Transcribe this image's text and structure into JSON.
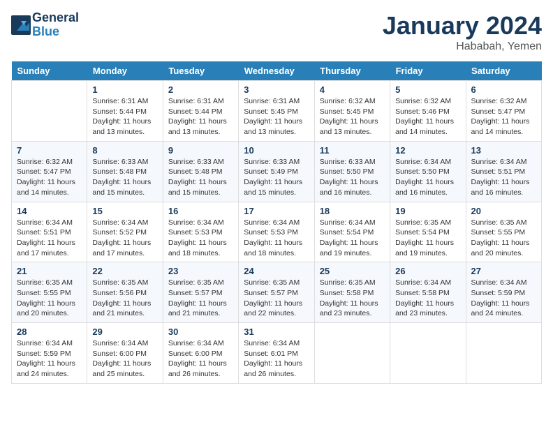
{
  "header": {
    "logo_line1": "General",
    "logo_line2": "Blue",
    "month_year": "January 2024",
    "location": "Hababah, Yemen"
  },
  "weekdays": [
    "Sunday",
    "Monday",
    "Tuesday",
    "Wednesday",
    "Thursday",
    "Friday",
    "Saturday"
  ],
  "weeks": [
    [
      {
        "num": "",
        "info": ""
      },
      {
        "num": "1",
        "info": "Sunrise: 6:31 AM\nSunset: 5:44 PM\nDaylight: 11 hours\nand 13 minutes."
      },
      {
        "num": "2",
        "info": "Sunrise: 6:31 AM\nSunset: 5:44 PM\nDaylight: 11 hours\nand 13 minutes."
      },
      {
        "num": "3",
        "info": "Sunrise: 6:31 AM\nSunset: 5:45 PM\nDaylight: 11 hours\nand 13 minutes."
      },
      {
        "num": "4",
        "info": "Sunrise: 6:32 AM\nSunset: 5:45 PM\nDaylight: 11 hours\nand 13 minutes."
      },
      {
        "num": "5",
        "info": "Sunrise: 6:32 AM\nSunset: 5:46 PM\nDaylight: 11 hours\nand 14 minutes."
      },
      {
        "num": "6",
        "info": "Sunrise: 6:32 AM\nSunset: 5:47 PM\nDaylight: 11 hours\nand 14 minutes."
      }
    ],
    [
      {
        "num": "7",
        "info": "Sunrise: 6:32 AM\nSunset: 5:47 PM\nDaylight: 11 hours\nand 14 minutes."
      },
      {
        "num": "8",
        "info": "Sunrise: 6:33 AM\nSunset: 5:48 PM\nDaylight: 11 hours\nand 15 minutes."
      },
      {
        "num": "9",
        "info": "Sunrise: 6:33 AM\nSunset: 5:48 PM\nDaylight: 11 hours\nand 15 minutes."
      },
      {
        "num": "10",
        "info": "Sunrise: 6:33 AM\nSunset: 5:49 PM\nDaylight: 11 hours\nand 15 minutes."
      },
      {
        "num": "11",
        "info": "Sunrise: 6:33 AM\nSunset: 5:50 PM\nDaylight: 11 hours\nand 16 minutes."
      },
      {
        "num": "12",
        "info": "Sunrise: 6:34 AM\nSunset: 5:50 PM\nDaylight: 11 hours\nand 16 minutes."
      },
      {
        "num": "13",
        "info": "Sunrise: 6:34 AM\nSunset: 5:51 PM\nDaylight: 11 hours\nand 16 minutes."
      }
    ],
    [
      {
        "num": "14",
        "info": "Sunrise: 6:34 AM\nSunset: 5:51 PM\nDaylight: 11 hours\nand 17 minutes."
      },
      {
        "num": "15",
        "info": "Sunrise: 6:34 AM\nSunset: 5:52 PM\nDaylight: 11 hours\nand 17 minutes."
      },
      {
        "num": "16",
        "info": "Sunrise: 6:34 AM\nSunset: 5:53 PM\nDaylight: 11 hours\nand 18 minutes."
      },
      {
        "num": "17",
        "info": "Sunrise: 6:34 AM\nSunset: 5:53 PM\nDaylight: 11 hours\nand 18 minutes."
      },
      {
        "num": "18",
        "info": "Sunrise: 6:34 AM\nSunset: 5:54 PM\nDaylight: 11 hours\nand 19 minutes."
      },
      {
        "num": "19",
        "info": "Sunrise: 6:35 AM\nSunset: 5:54 PM\nDaylight: 11 hours\nand 19 minutes."
      },
      {
        "num": "20",
        "info": "Sunrise: 6:35 AM\nSunset: 5:55 PM\nDaylight: 11 hours\nand 20 minutes."
      }
    ],
    [
      {
        "num": "21",
        "info": "Sunrise: 6:35 AM\nSunset: 5:55 PM\nDaylight: 11 hours\nand 20 minutes."
      },
      {
        "num": "22",
        "info": "Sunrise: 6:35 AM\nSunset: 5:56 PM\nDaylight: 11 hours\nand 21 minutes."
      },
      {
        "num": "23",
        "info": "Sunrise: 6:35 AM\nSunset: 5:57 PM\nDaylight: 11 hours\nand 21 minutes."
      },
      {
        "num": "24",
        "info": "Sunrise: 6:35 AM\nSunset: 5:57 PM\nDaylight: 11 hours\nand 22 minutes."
      },
      {
        "num": "25",
        "info": "Sunrise: 6:35 AM\nSunset: 5:58 PM\nDaylight: 11 hours\nand 23 minutes."
      },
      {
        "num": "26",
        "info": "Sunrise: 6:34 AM\nSunset: 5:58 PM\nDaylight: 11 hours\nand 23 minutes."
      },
      {
        "num": "27",
        "info": "Sunrise: 6:34 AM\nSunset: 5:59 PM\nDaylight: 11 hours\nand 24 minutes."
      }
    ],
    [
      {
        "num": "28",
        "info": "Sunrise: 6:34 AM\nSunset: 5:59 PM\nDaylight: 11 hours\nand 24 minutes."
      },
      {
        "num": "29",
        "info": "Sunrise: 6:34 AM\nSunset: 6:00 PM\nDaylight: 11 hours\nand 25 minutes."
      },
      {
        "num": "30",
        "info": "Sunrise: 6:34 AM\nSunset: 6:00 PM\nDaylight: 11 hours\nand 26 minutes."
      },
      {
        "num": "31",
        "info": "Sunrise: 6:34 AM\nSunset: 6:01 PM\nDaylight: 11 hours\nand 26 minutes."
      },
      {
        "num": "",
        "info": ""
      },
      {
        "num": "",
        "info": ""
      },
      {
        "num": "",
        "info": ""
      }
    ]
  ]
}
